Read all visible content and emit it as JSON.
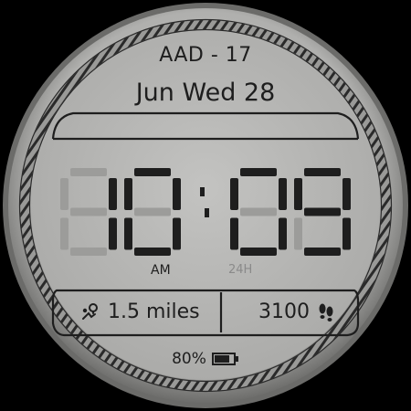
{
  "watch": {
    "top_label": "AAD - 17",
    "date": "Jun Wed 28",
    "time": {
      "hours": "10",
      "minutes": "09"
    },
    "ampm": "AM",
    "format_24h": "24H",
    "distance": "1.5 miles",
    "steps": "3100",
    "battery_percent": "80%",
    "battery_level": 0.8
  },
  "colors": {
    "background": "#000000",
    "face": "#b4b4b2",
    "text": "#1e1e1e",
    "segment_off": "#9c9c9a",
    "dim_text": "#8a8a8a"
  },
  "icons": {
    "distance": "route-icon",
    "steps": "footprints-icon",
    "battery": "battery-icon"
  }
}
